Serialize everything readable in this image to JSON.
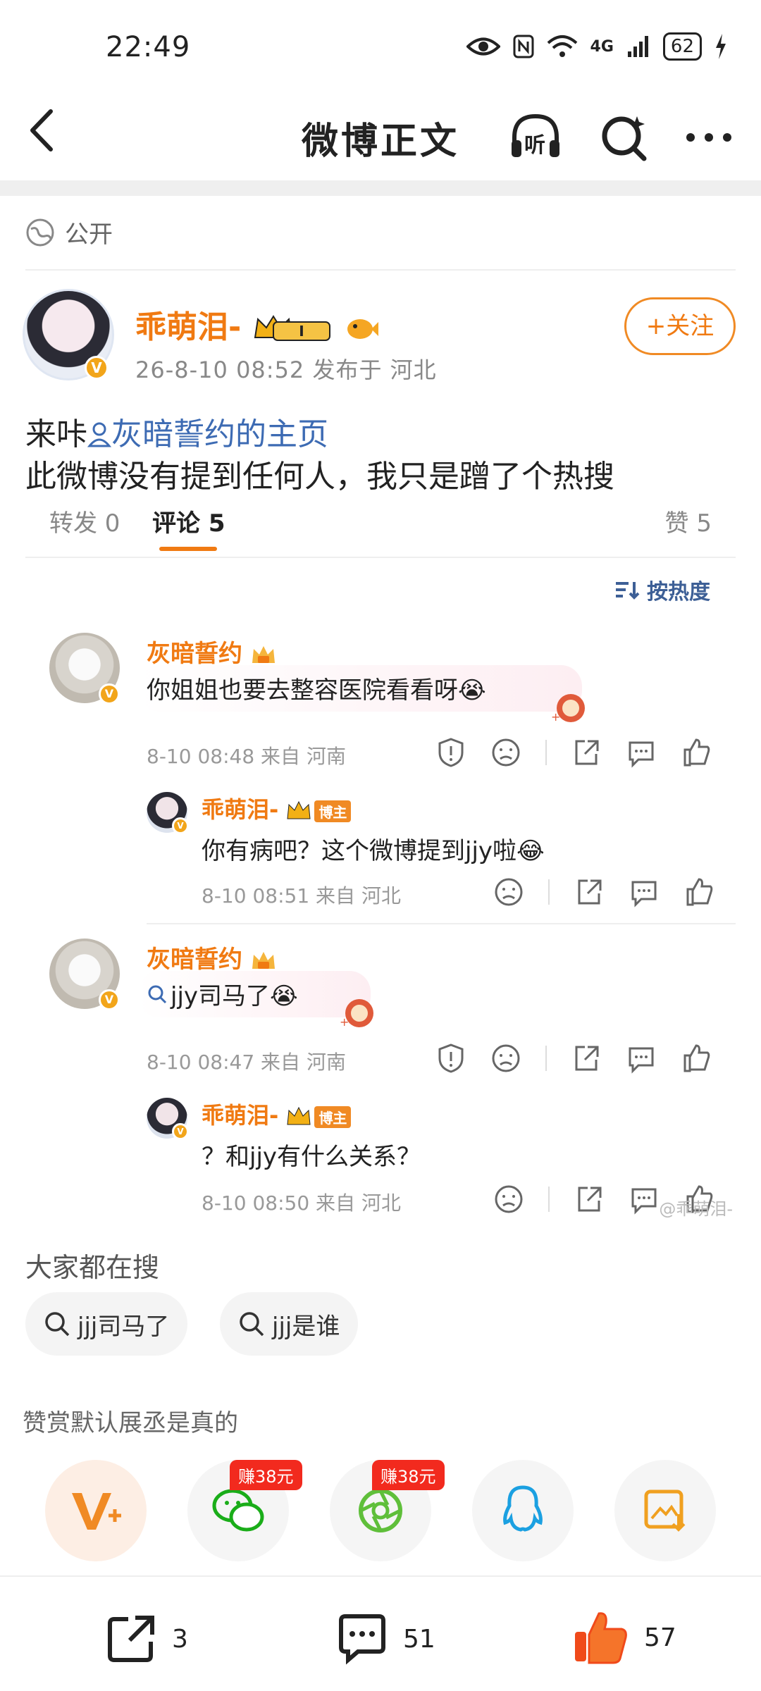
{
  "status_bar": {
    "time": "22:49",
    "network": "4G",
    "battery": "62"
  },
  "nav": {
    "title": "微博正文",
    "listen_label": "听"
  },
  "visibility": {
    "label": "公开"
  },
  "post": {
    "author": "乖萌泪-",
    "level": "I",
    "meta": "26-8-10 08:52 发布于 河北",
    "follow_label": "+关注",
    "line1_prefix": "来咔",
    "line1_mention": "灰暗誓约的主页",
    "line2": "此微博没有提到任何人，我只是蹭了个热搜"
  },
  "tabs": {
    "repost": "转发 0",
    "comment": "评论 5",
    "like": "赞 5"
  },
  "sort": {
    "label": "按热度"
  },
  "comments": [
    {
      "name": "灰暗誓约",
      "text": "你姐姐也要去整容医院看看呀😭",
      "meta": "8-10 08:48 来自 河南",
      "reply": {
        "name": "乖萌泪-",
        "tag": "博主",
        "text": "你有病吧？这个微博提到jjy啦😂",
        "meta": "8-10 08:51 来自 河北"
      }
    },
    {
      "name": "灰暗誓约",
      "text": "jjy司马了😭",
      "meta": "8-10 08:47 来自 河南",
      "reply": {
        "name": "乖萌泪-",
        "tag": "博主",
        "text": "？和jjy有什么关系？",
        "meta": "8-10 08:50 来自 河北"
      }
    }
  ],
  "watermark": "@乖萌泪-",
  "hot_search": {
    "title": "大家都在搜",
    "chips": [
      "jjj司马了",
      "jjj是谁"
    ]
  },
  "reward_text": "赞赏默认展丞是真的",
  "share": {
    "earn1": "赚38元",
    "earn2": "赚38元"
  },
  "bottom_bar": {
    "reposts": "3",
    "comments": "51",
    "likes": "57"
  },
  "colors": {
    "accent": "#f07a12",
    "link": "#3d6bb3",
    "earn_badge": "#f22a1e"
  }
}
